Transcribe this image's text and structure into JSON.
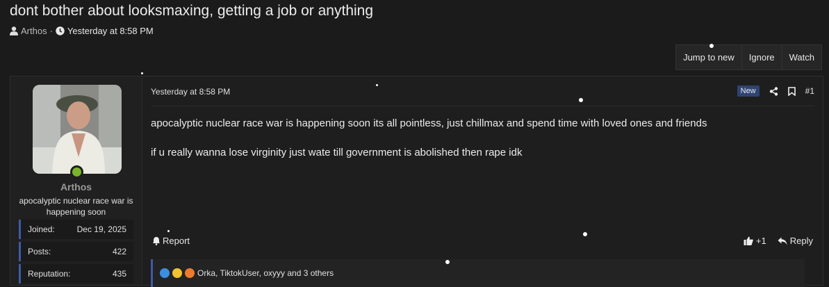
{
  "thread": {
    "title": "dont bother about looksmaxing, getting a job or anything",
    "author": "Arthos",
    "separator": "·",
    "date": "Yesterday at 8:58 PM"
  },
  "toolbar": {
    "jump": "Jump to new",
    "ignore": "Ignore",
    "watch": "Watch"
  },
  "user": {
    "name": "Arthos",
    "title": "apocalyptic nuclear race war is happening soon",
    "stats": [
      {
        "label": "Joined:",
        "value": "Dec 19, 2025"
      },
      {
        "label": "Posts:",
        "value": "422"
      },
      {
        "label": "Reputation:",
        "value": "435"
      }
    ]
  },
  "post": {
    "date": "Yesterday at 8:58 PM",
    "badge": "New",
    "number": "#1",
    "paragraphs": [
      "apocalyptic nuclear race war is happening soon its all pointless, just chillmax and spend time with loved ones and friends",
      "if u really wanna lose virginity just wate till government is abolished then rape idk"
    ],
    "report": "Report",
    "like": "+1",
    "reply": "Reply",
    "reactions": "Orka, TiktokUser, oxyyy and 3 others"
  },
  "icons": {
    "user": "user-icon",
    "clock": "clock-icon",
    "share": "share-icon",
    "bookmark": "bookmark-icon",
    "bell": "bell-icon",
    "thumbs_up": "thumbs-up-icon",
    "reply": "reply-icon"
  },
  "colors": {
    "accent": "#3f5aa8",
    "online": "#7bb52b",
    "badge": "#2f4372"
  }
}
